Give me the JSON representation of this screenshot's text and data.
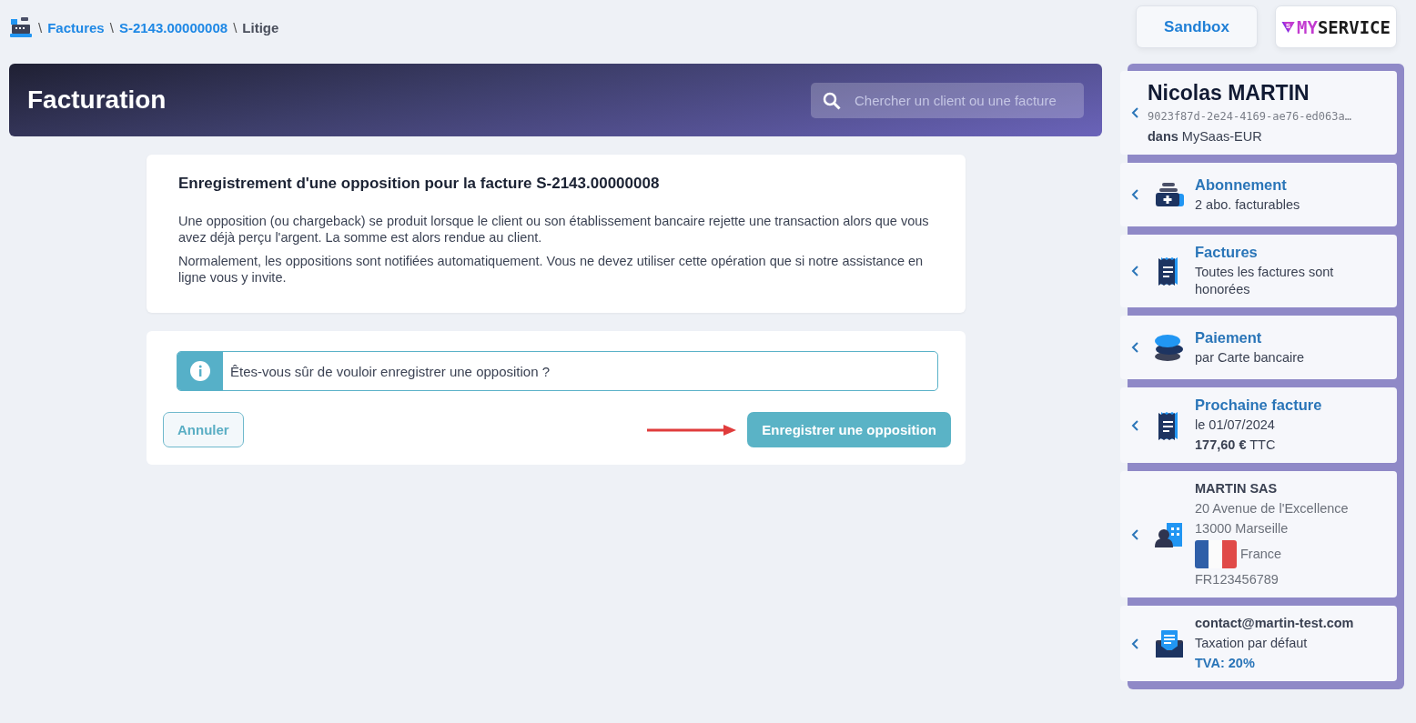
{
  "breadcrumb": {
    "items": [
      {
        "label": "Factures",
        "kind": "link"
      },
      {
        "label": "S-2143.00000008",
        "kind": "link"
      },
      {
        "label": "Litige",
        "kind": "current"
      }
    ],
    "separator": "\\"
  },
  "top_buttons": {
    "environment": "Sandbox",
    "logo": {
      "mark": "S",
      "accent": "MY",
      "name": "SERVICE"
    }
  },
  "banner": {
    "title": "Facturation",
    "search": {
      "placeholder": "Chercher un client ou une facture"
    }
  },
  "notice": {
    "title": "Enregistrement d'une opposition pour la facture S-2143.00000008",
    "paragraphs": [
      "Une opposition (ou chargeback) se produit lorsque le client ou son établissement bancaire rejette une transaction alors que vous avez déjà perçu l'argent. La somme est alors rendue au client.",
      "Normalement, les oppositions sont notifiées automatiquement. Vous ne devez utiliser cette opération que si notre assistance en ligne vous y invite."
    ]
  },
  "confirm": {
    "message": "Êtes-vous sûr de vouloir enregistrer une opposition ?",
    "cancel": "Annuler",
    "submit": "Enregistrer une opposition"
  },
  "sidebar": {
    "cards": [
      {
        "kind": "customer",
        "title": "Nicolas MARTIN",
        "lines": [
          {
            "kind": "mono",
            "text": "9023f87d-2e24-4169-ae76-ed063a…"
          },
          {
            "kind": "plain",
            "text": "**dans** MySaas-EUR"
          }
        ]
      },
      {
        "kind": "subscription",
        "title": "Abonnement",
        "lines": [
          {
            "kind": "plain",
            "text": "2 abo. facturables"
          }
        ]
      },
      {
        "kind": "invoices",
        "title": "Factures",
        "lines": [
          {
            "kind": "plain",
            "text": "Toutes les factures sont honorées"
          }
        ]
      },
      {
        "kind": "payment",
        "title": "Paiement",
        "lines": [
          {
            "kind": "plain",
            "text": "par Carte bancaire"
          }
        ]
      },
      {
        "kind": "next_invoice",
        "title": "Prochaine facture",
        "lines": [
          {
            "kind": "plain",
            "text": "le 01/07/2024"
          },
          {
            "kind": "plain",
            "text": "**177,60 €** TTC"
          }
        ]
      },
      {
        "kind": "company",
        "title": "MARTIN SAS",
        "lines": [
          {
            "kind": "muted",
            "text": "20 Avenue de l'Excellence"
          },
          {
            "kind": "muted",
            "text": "13000   Marseille"
          },
          {
            "kind": "flag",
            "text": "France"
          },
          {
            "kind": "muted",
            "text": "FR123456789"
          }
        ]
      },
      {
        "kind": "contact",
        "title": "contact@martin-test.com",
        "lines": [
          {
            "kind": "plain",
            "text": "Taxation par défaut"
          },
          {
            "kind": "accent",
            "text": "TVA: 20%"
          }
        ]
      }
    ]
  }
}
